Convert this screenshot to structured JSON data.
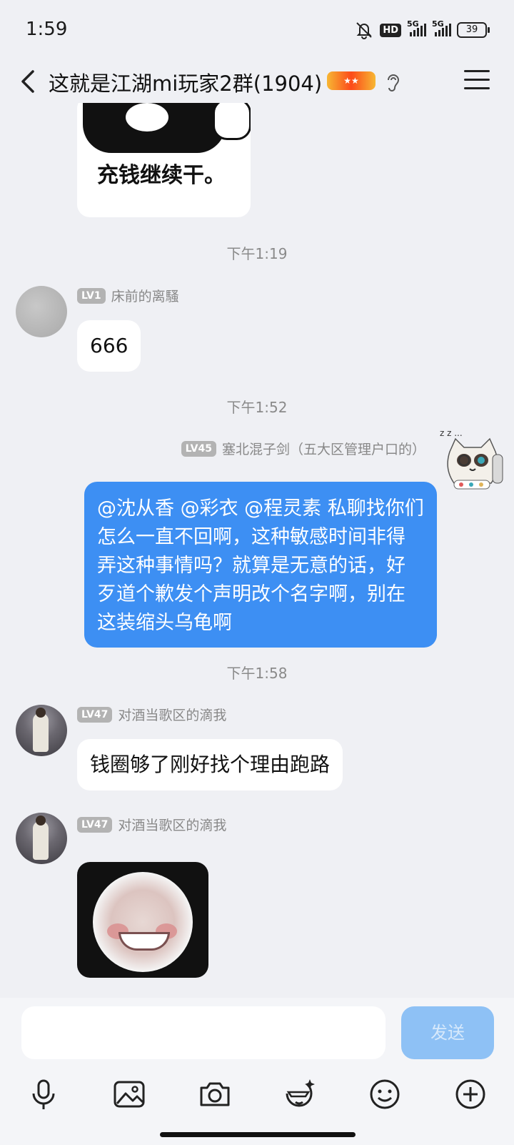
{
  "status": {
    "time": "1:59",
    "hd": "HD",
    "net1": "5G",
    "net2": "5G",
    "battery": "39"
  },
  "header": {
    "title": "这就是江湖mi玩家2群(1904)"
  },
  "messages": {
    "sticker_text": "充钱继续干。",
    "ts1": "下午1:19",
    "m1": {
      "level": "LV1",
      "name": "床前的离騷",
      "text": "666"
    },
    "ts2": "下午1:52",
    "m2": {
      "level": "LV45",
      "name": "塞北混子剑（五大区管理户口的）",
      "text": "@沈从香 @彩衣 @程灵素 私聊找你们怎么一直不回啊，这种敏感时间非得弄这种事情吗？就算是无意的话，好歹道个歉发个声明改个名字啊，别在这装缩头乌龟啊"
    },
    "ts3": "下午1:58",
    "m3": {
      "level": "LV47",
      "name": "对酒当歌区的滴我",
      "text": "钱圈够了刚好找个理由跑路"
    },
    "m4": {
      "level": "LV47",
      "name": "对酒当歌区的滴我"
    }
  },
  "input": {
    "placeholder": "",
    "send_label": "发送"
  },
  "toolbar": [
    "mic-icon",
    "image-icon",
    "camera-icon",
    "sticker-icon",
    "emoji-icon",
    "plus-icon"
  ]
}
